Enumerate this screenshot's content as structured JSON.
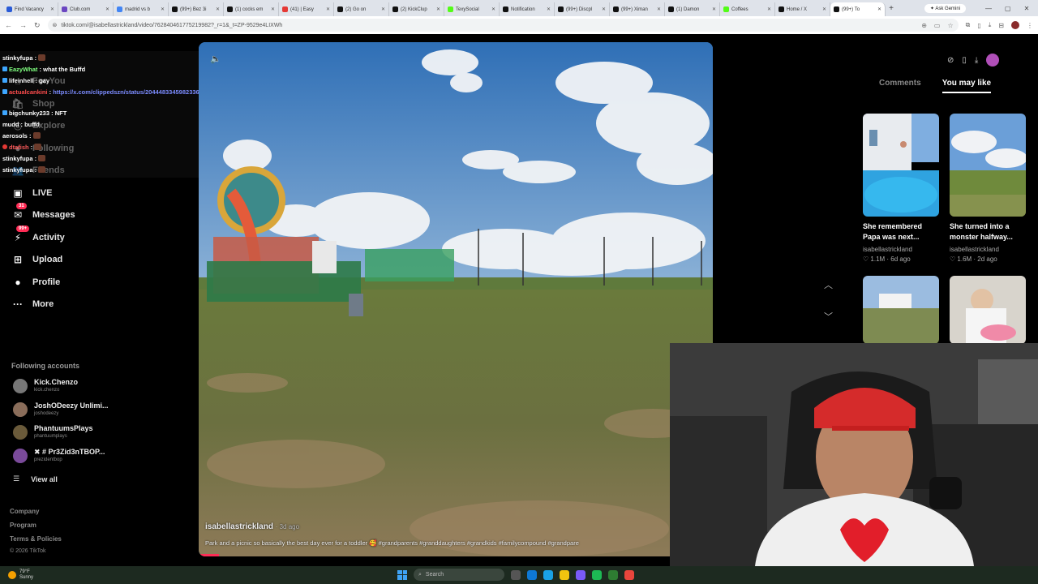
{
  "browser": {
    "tabs": [
      {
        "label": "Find Vacancy",
        "color": "#2a5bd7"
      },
      {
        "label": "Club.com",
        "color": "#6b46c1"
      },
      {
        "label": "madrid vs b",
        "color": "#4285f4"
      },
      {
        "label": "(99+) Bez 3i",
        "color": "#111111"
      },
      {
        "label": "(1) cocks em",
        "color": "#111111"
      },
      {
        "label": "(41) | Easy",
        "color": "#e53935"
      },
      {
        "label": "(2) Go on",
        "color": "#111111"
      },
      {
        "label": "(2) KickClup",
        "color": "#111111"
      },
      {
        "label": "TexySocial",
        "color": "#53fc18"
      },
      {
        "label": "Notification",
        "color": "#111111"
      },
      {
        "label": "(99+) Discpl",
        "color": "#111111"
      },
      {
        "label": "(99+) Ximan",
        "color": "#111111"
      },
      {
        "label": "(1) Damon",
        "color": "#111111"
      },
      {
        "label": "Coffees",
        "color": "#53fc18"
      },
      {
        "label": "Home / X",
        "color": "#111111"
      },
      {
        "label": "(99+) To",
        "color": "#111111",
        "active": true
      }
    ],
    "new_tab": "+",
    "ask_gemini": "✦ Ask Gemini",
    "window_controls": [
      "—",
      "▢",
      "✕"
    ],
    "url": "tiktok.com/@isabellastrickland/video/762840461775219982?_r=1&_t=ZP-9529e4LIXWh"
  },
  "sidebar": {
    "nav": [
      {
        "label": "For You",
        "icon": "home-icon",
        "glyph": "⌂"
      },
      {
        "label": "Shop",
        "icon": "shop-icon",
        "glyph": "🛍"
      },
      {
        "label": "Explore",
        "icon": "compass-icon",
        "glyph": "◎"
      },
      {
        "label": "Following",
        "icon": "following-icon",
        "glyph": "●"
      },
      {
        "label": "Friends",
        "icon": "friends-icon",
        "glyph": "👥"
      },
      {
        "label": "LIVE",
        "icon": "live-icon",
        "glyph": "▣"
      },
      {
        "label": "Messages",
        "icon": "messages-icon",
        "glyph": "✉",
        "badge": "31"
      },
      {
        "label": "Activity",
        "icon": "activity-icon",
        "glyph": "⚡",
        "badge": "99+"
      },
      {
        "label": "Upload",
        "icon": "upload-icon",
        "glyph": "⊞"
      },
      {
        "label": "Profile",
        "icon": "profile-icon",
        "glyph": "●"
      },
      {
        "label": "More",
        "icon": "more-icon",
        "glyph": "···"
      }
    ],
    "following_title": "Following accounts",
    "accounts": [
      {
        "name": "Kick.Chenzo",
        "user": "kick.chenzo"
      },
      {
        "name": "JoshODeezy Unlimi...",
        "user": "joshodeezy"
      },
      {
        "name": "PhantuumsPlays",
        "user": "phantuumplays"
      },
      {
        "name": "✖ # Pr3Zid3nTBOP...",
        "user": "prezidentbop"
      }
    ],
    "view_all": "View all",
    "footer": [
      "Company",
      "Program",
      "Terms & Policies",
      "© 2026 TikTok"
    ]
  },
  "chat": [
    {
      "user": "stinkyfupa",
      "sep": " : ",
      "msg": "",
      "emote": true,
      "ucolor": "#ffffff"
    },
    {
      "user": "EazyWhat",
      "sep": " : ",
      "msg": "what the Buffd",
      "ucolor": "#7fff7f",
      "badge": "blue"
    },
    {
      "user": "lifeinhell",
      "sep": " : ",
      "msg": "gay",
      "ucolor": "#ffffff",
      "badge": "blue"
    },
    {
      "user": "actualcankini",
      "sep": " : ",
      "msg": "https://x.com/clippedszn/status/2044483345982336l8?s=46",
      "ucolor": "#ff4d4d",
      "badge": "blue",
      "link": true
    },
    {
      "user": "bigchunky233",
      "sep": " : ",
      "msg": "NFT",
      "ucolor": "#ffffff",
      "badge": "blue"
    },
    {
      "user": "mudd",
      "sep": " : ",
      "msg": "buffd",
      "ucolor": "#ffffff"
    },
    {
      "user": "aerosols",
      "sep": " : ",
      "msg": "",
      "emote": true,
      "ucolor": "#ffffff"
    },
    {
      "user": "dtafish",
      "sep": " : ",
      "msg": "",
      "emote": true,
      "ucolor": "#ff5a5a",
      "badge": "red"
    },
    {
      "user": "stinkyfupa",
      "sep": " : ",
      "msg": "",
      "emote": true,
      "ucolor": "#ffffff"
    },
    {
      "user": "stinkyfupa",
      "sep": " : ",
      "msg": "",
      "emote": true,
      "ucolor": "#ffffff"
    }
  ],
  "video": {
    "author": "isabellastrickland",
    "time_ago": "· 3d ago",
    "description": "Park and a picnic so basically the best day ever for a toddler 🥰 #grandparents #granddaughters #grandkids #familycompound #grandpare",
    "progress": 0.04
  },
  "right_panel": {
    "tabs": {
      "comments": "Comments",
      "you_may_like": "You may like"
    },
    "items": [
      {
        "title": "She remembered Papa was next...",
        "author": "isabellastrickland",
        "stats": "♡ 1.1M · 6d ago"
      },
      {
        "title": "She turned into a monster halfway...",
        "author": "isabellastrickland",
        "stats": "♡ 1.6M · 2d ago"
      }
    ]
  },
  "taskbar": {
    "temp": "79°F",
    "condition": "Sunny",
    "search": "Search"
  }
}
